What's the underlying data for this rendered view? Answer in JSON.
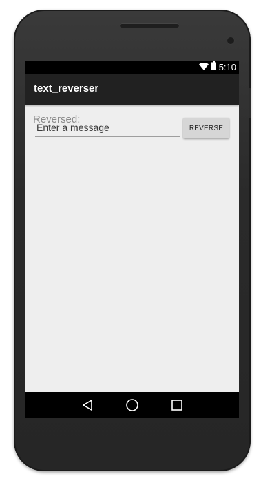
{
  "status_bar": {
    "time": "5:10",
    "icons": [
      "wifi-icon",
      "battery-icon"
    ]
  },
  "action_bar": {
    "title": "text_reverser"
  },
  "main": {
    "reversed_label": "Reversed:",
    "message_input": {
      "placeholder": "Enter a message",
      "value": ""
    },
    "reverse_button_label": "REVERSE"
  },
  "nav_bar": {
    "buttons": [
      "back-icon",
      "home-icon",
      "recents-icon"
    ]
  },
  "colors": {
    "screen_background": "#eeeeee",
    "action_bar": "#212121",
    "status_bar": "#000000",
    "button": "#d6d6d6"
  }
}
